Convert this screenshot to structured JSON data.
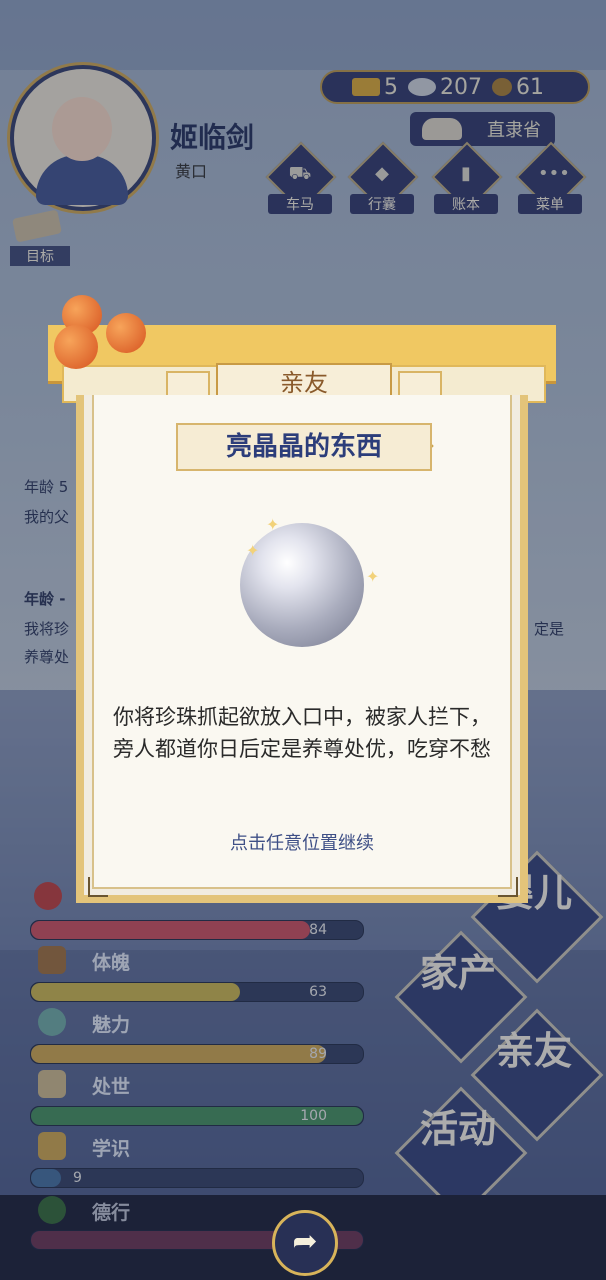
{
  "player": {
    "name": "姬临剑",
    "status": "黄口"
  },
  "resources": {
    "gold": "5",
    "silver": "207",
    "coin": "61"
  },
  "location": "直隶省",
  "menu": [
    {
      "label": "车马",
      "icon": "carriage-icon"
    },
    {
      "label": "行囊",
      "icon": "bag-icon"
    },
    {
      "label": "账本",
      "icon": "ledger-icon"
    },
    {
      "label": "菜单",
      "icon": "more-icon"
    }
  ],
  "goal_label": "目标",
  "log": {
    "line1_head": "年龄 5",
    "line1_text": "我的父",
    "line2_head": "年龄 -",
    "line2_text_a": "我将珍",
    "line2_text_b": "定是",
    "line2_text_c": "养尊处"
  },
  "stats": [
    {
      "label": "",
      "value": 84,
      "max": 100,
      "color": "#c84a5a"
    },
    {
      "label": "体魄",
      "value": 63,
      "max": 100,
      "color": "#c6b14a"
    },
    {
      "label": "魅力",
      "value": 89,
      "max": 100,
      "color": "#c9a14a"
    },
    {
      "label": "处世",
      "value": 100,
      "max": 100,
      "color": "#3f8a5a"
    },
    {
      "label": "学识",
      "value": 9,
      "max": 100,
      "color": "#3f6a9a"
    },
    {
      "label": "德行",
      "value": 100,
      "max": 100,
      "color": "#7a3a5a"
    }
  ],
  "big_buttons": {
    "b1": "婴儿",
    "b2": "家产",
    "b3": "亲友",
    "b4": "活动"
  },
  "dialog": {
    "tab": "亲友",
    "heading": "亮晶晶的东西",
    "description": "你将珍珠抓起欲放入口中，被家人拦下，旁人都道你日后定是养尊处优，吃穿不愁",
    "continue": "点击任意位置继续"
  }
}
